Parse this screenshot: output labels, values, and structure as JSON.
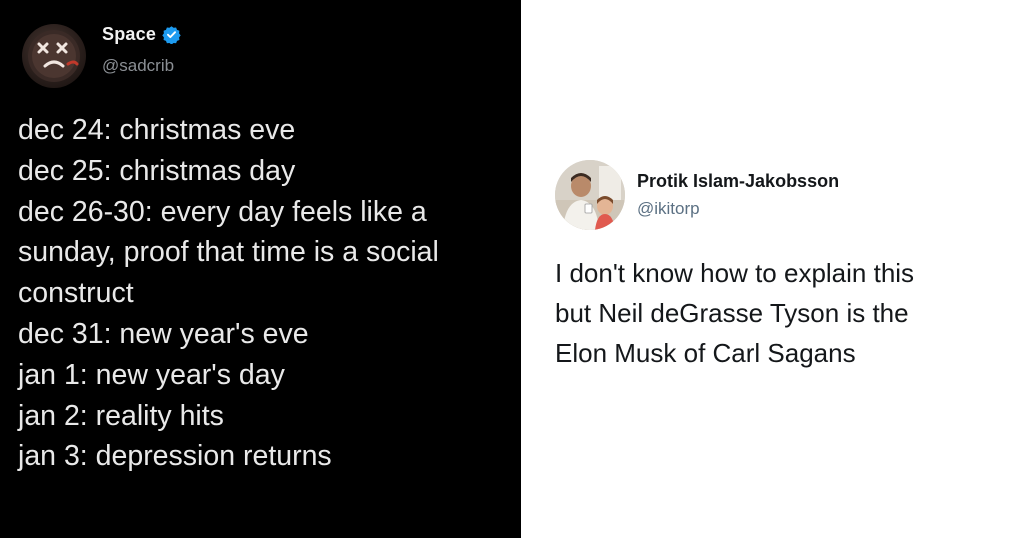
{
  "left_tweet": {
    "display_name": "Space",
    "handle": "@sadcrib",
    "verified": true,
    "avatar_icon": "xx-dead-face-avatar",
    "lines": [
      "dec 24: christmas eve",
      "dec 25: christmas day",
      "dec 26-30: every day feels like a",
      "sunday, proof that time is a social",
      "construct",
      "dec 31: new year's eve",
      "jan 1: new year's day",
      "jan 2: reality hits",
      "jan 3: depression returns"
    ]
  },
  "right_tweet": {
    "display_name": "Protik Islam-Jakobsson",
    "handle": "@ikitorp",
    "avatar_icon": "profile-photo-avatar",
    "lines": [
      "I don't know how to explain this",
      "but Neil deGrasse Tyson is the",
      "Elon Musk of Carl Sagans"
    ]
  },
  "colors": {
    "left_background": "#000000",
    "right_background": "#ffffff",
    "verified_blue": "#1d9bf0",
    "dark_text": "#e9e9e9",
    "dark_handle": "#8b8f94",
    "light_text": "#14171a",
    "light_handle": "#5b7083"
  }
}
